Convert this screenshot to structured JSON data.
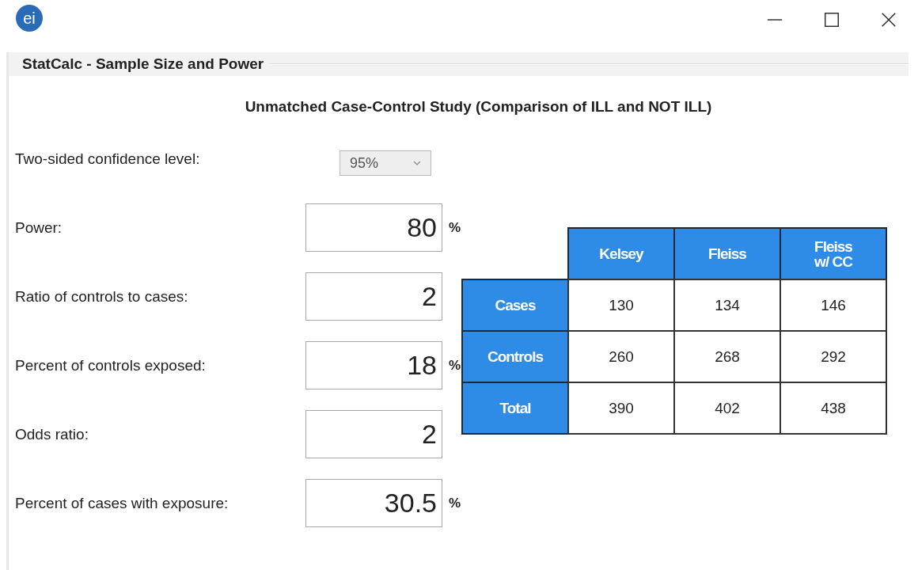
{
  "window": {
    "icon_text": "ei"
  },
  "group": {
    "title": "StatCalc - Sample Size and Power"
  },
  "heading": "Unmatched Case-Control Study (Comparison of ILL and NOT ILL)",
  "fields": [
    {
      "kind": "dropdown",
      "label": "Two-sided confidence level:",
      "value": "95%"
    },
    {
      "kind": "input",
      "label": "Power:",
      "value": "80",
      "unit": "%"
    },
    {
      "kind": "input",
      "label": "Ratio of controls to cases:",
      "value": "2"
    },
    {
      "kind": "input",
      "label": "Percent of controls exposed:",
      "value": "18",
      "unit": "%"
    },
    {
      "kind": "input",
      "label": "Odds ratio:",
      "value": "2"
    },
    {
      "kind": "input",
      "label": "Percent of cases with exposure:",
      "value": "30.5",
      "unit": "%"
    }
  ],
  "table": {
    "columns": [
      "Kelsey",
      "Fleiss",
      "Fleiss\nw/ CC"
    ],
    "rows": [
      {
        "label": "Cases",
        "values": [
          "130",
          "134",
          "146"
        ]
      },
      {
        "label": "Controls",
        "values": [
          "260",
          "268",
          "292"
        ]
      },
      {
        "label": "Total",
        "values": [
          "390",
          "402",
          "438"
        ]
      }
    ]
  }
}
